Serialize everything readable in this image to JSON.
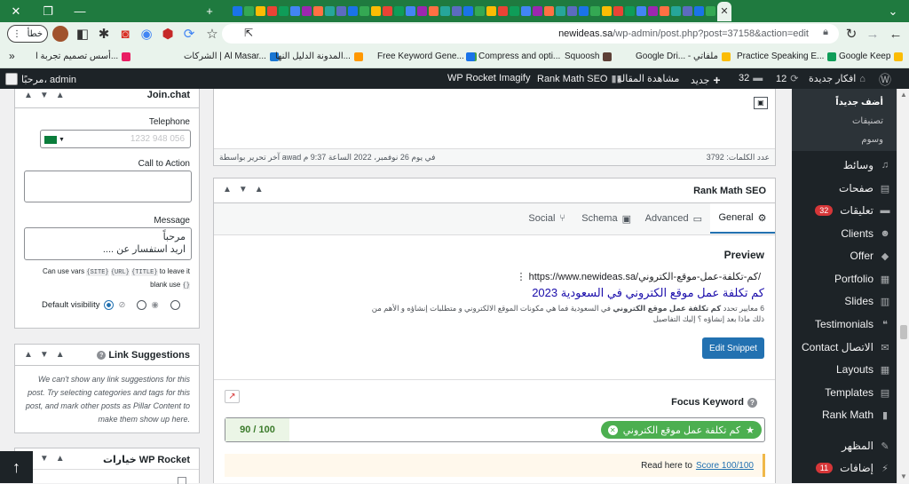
{
  "browser": {
    "url_domain": "newideas.sa",
    "url_path": "/wp-admin/post.php?post=37158&action=edit",
    "error_button": "خطأ"
  },
  "bookmarks": [
    "أسس تصميم تجربة ا...",
    "الشركات | Al Masar...",
    "المدونة الدليل النها...",
    "Free Keyword Gene...",
    "Compress and opti...",
    "Squoosh",
    "Google Dri... - ملفاتي",
    "Practice Speaking E...",
    "Google Keep"
  ],
  "adminbar": {
    "greeting": "مرحبًا، admin",
    "wp_rocket": "WP Rocket",
    "imagify": "Imagify",
    "rank_math": "Rank Math SEO",
    "view_post": "مشاهدة المقالة",
    "new": "جديد",
    "comments_count": "32",
    "updates_count": "12",
    "site_name": "افكار جديدة"
  },
  "wpmenu": {
    "submenu": [
      "أضف جديداً",
      "تصنيفات",
      "وسوم"
    ],
    "items": [
      {
        "label": "وسائط",
        "badge": ""
      },
      {
        "label": "صفحات",
        "badge": ""
      },
      {
        "label": "تعليقات",
        "badge": "32"
      },
      {
        "label": "Clients",
        "badge": ""
      },
      {
        "label": "Offer",
        "badge": ""
      },
      {
        "label": "Portfolio",
        "badge": ""
      },
      {
        "label": "Slides",
        "badge": ""
      },
      {
        "label": "Testimonials",
        "badge": ""
      },
      {
        "label": "Contact الاتصال",
        "badge": ""
      },
      {
        "label": "Layouts",
        "badge": ""
      },
      {
        "label": "Templates",
        "badge": ""
      },
      {
        "label": "Rank Math",
        "badge": ""
      },
      {
        "label": "المظهر",
        "badge": ""
      },
      {
        "label": "إضافات",
        "badge": "11"
      }
    ]
  },
  "joinchat": {
    "title": "Join.chat",
    "telephone_label": "Telephone",
    "telephone_placeholder": "1232 948 056",
    "cta_label": "Call to Action",
    "message_label": "Message",
    "message_value": "مرحباً\nاريد استفسار عن ....",
    "vars_help_1": "Can use vars",
    "vars": [
      "{SITE}",
      "{URL}",
      "{TITLE}"
    ],
    "vars_help_2": "to leave it",
    "vars_help_3": "blank use",
    "vars_empty": "{}",
    "visibility_label": "Default visibility"
  },
  "link_suggestions": {
    "title": "Link Suggestions",
    "body": "We can't show any link suggestions for this post. Try selecting categories and tags for this post, and mark other posts as Pillar Content to make them show up here."
  },
  "wprocket": {
    "title": "خيارات WP Rocket"
  },
  "editor": {
    "word_count": "عدد الكلمات: 3792",
    "last_edit": "آخر تحرير بواسطة awad في يوم 26 نوفمبر، 2022 الساعة 9:37 م"
  },
  "rankmath": {
    "title": "Rank Math SEO",
    "tabs": [
      "General",
      "Advanced",
      "Schema",
      "Social"
    ],
    "preview_heading": "Preview",
    "preview_url": "https://www.newideas.sa/كم-تكلفة-عمل-موقع-الكتروني/",
    "preview_title": "كم تكلفة عمل موقع الكتروني في السعودية 2023",
    "preview_desc": "6 معايير تحدد كم تكلفة عمل موقع الكتروني في السعودية فما هي مكونات الموقع الالكتروني و متطلبات إنشاؤه و الأهم من ذلك ماذا بعد إنشاؤه ؟ إليك التفاصيل",
    "preview_desc_bold": "كم تكلفة عمل موقع الكتروني",
    "edit_snippet": "Edit Snippet",
    "focus_keyword_label": "Focus Keyword",
    "keyword": "كم تكلفة عمل موقع الكتروني",
    "score": "90 / 100",
    "read_here": "Read here to",
    "score_link": "Score 100/100"
  },
  "colors": {
    "tab_green": "#1f7a3f",
    "wp_dark": "#1d2327",
    "wp_blue": "#2271b1",
    "badge_red": "#d63638",
    "keyword_green": "#4caf50"
  }
}
